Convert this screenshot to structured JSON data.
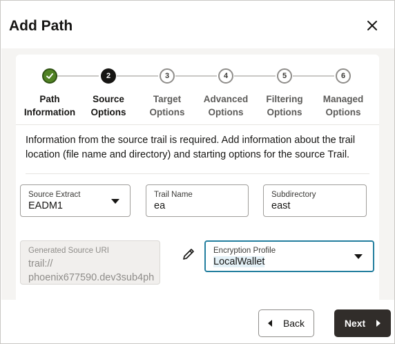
{
  "dialog": {
    "title": "Add Path",
    "close_icon": "close-icon"
  },
  "train": {
    "steps": [
      {
        "line1": "Path",
        "line2": "Information",
        "number": "",
        "state": "done"
      },
      {
        "line1": "Source",
        "line2": "Options",
        "number": "2",
        "state": "current"
      },
      {
        "line1": "Target",
        "line2": "Options",
        "number": "3",
        "state": "todo"
      },
      {
        "line1": "Advanced",
        "line2": "Options",
        "number": "4",
        "state": "todo"
      },
      {
        "line1": "Filtering",
        "line2": "Options",
        "number": "5",
        "state": "todo"
      },
      {
        "line1": "Managed",
        "line2": "Options",
        "number": "6",
        "state": "todo"
      }
    ]
  },
  "description": "Information from the source trail is required. Add information about the trail location (file name and directory) and starting options for the source Trail.",
  "fields": {
    "source_extract": {
      "label": "Source Extract",
      "value": "EADM1"
    },
    "trail_name": {
      "label": "Trail Name",
      "value": "ea"
    },
    "subdirectory": {
      "label": "Subdirectory",
      "value": "east"
    },
    "generated_uri": {
      "label": "Generated Source URI",
      "value_line1": "trail://",
      "value_line2": "phoenix677590.dev3sub4ph"
    },
    "encryption_profile": {
      "label": "Encryption Profile",
      "value": "LocalWallet"
    }
  },
  "footer": {
    "back_label": "Back",
    "next_label": "Next"
  },
  "colors": {
    "done_step": "#508223",
    "current_step": "#161513",
    "focus_border": "#227e9e",
    "primary_button": "#312d2a"
  }
}
